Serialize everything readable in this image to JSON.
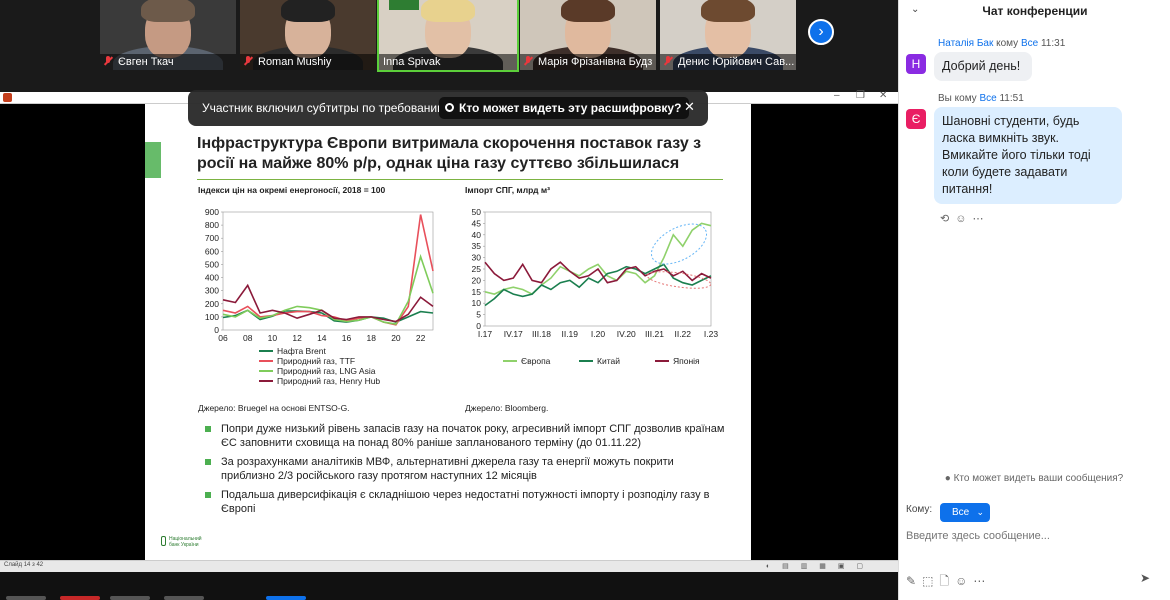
{
  "colors": {
    "zoom_blue": "#0e71eb",
    "accent_green": "#4caf50",
    "oil": "#1b7f4f",
    "ttf": "#e8505b",
    "lng": "#7fcc5b",
    "henry": "#8b1a3a",
    "china": "#1b7f4f",
    "japan": "#8b1a3a",
    "europe": "#8fd16b"
  },
  "gallery": {
    "participants": [
      {
        "name": "Євген Ткач",
        "muted": true
      },
      {
        "name": "Roman Mushiy",
        "muted": true
      },
      {
        "name": "Inna Spivak",
        "muted": false
      },
      {
        "name": "Марія Фрізанівна Будз",
        "muted": true
      },
      {
        "name": "Денис Юрійович Сав...",
        "muted": true
      }
    ],
    "next_icon": "chevron-right-icon"
  },
  "toast": {
    "text": "Участник включил субтитры по требованию",
    "button": "Кто может видеть эту расшифровку?",
    "close": "✕"
  },
  "slide": {
    "title": "Інфраструктура Європи витримала скорочення поставок газу з росії на майже 80% р/р, однак ціна газу суттєво збільшилася",
    "left_source": "Джерело: Bruegel на основі ENTSO-G.",
    "right_source": "Джерело: Bloomberg.",
    "bullets": [
      "Попри дуже низький рівень запасів газу на початок року, агресивний імпорт СПГ дозволив країнам ЄС заповнити сховища на понад 80% раніше запланованого терміну (до 01.11.22)",
      "За розрахунками аналітиків МВФ, альтернативні джерела газу та енергії можуть покрити приблизно 2/3 російського газу протягом наступних 12 місяців",
      "Подальша диверсифікація є складнішою через недостатні потужності імпорту і розподілу газу в Європі"
    ],
    "logo_line1": "Національний",
    "logo_line2": "банк України"
  },
  "chart_data": [
    {
      "type": "line",
      "title": "Індекси цін на окремі енергоносії, 2018 = 100",
      "x": [
        "06",
        "07",
        "08",
        "09",
        "10",
        "11",
        "12",
        "13",
        "14",
        "15",
        "16",
        "17",
        "18",
        "19",
        "20",
        "21",
        "22",
        "22.5"
      ],
      "x_ticks": [
        "06",
        "08",
        "10",
        "12",
        "14",
        "16",
        "18",
        "20",
        "22"
      ],
      "ylim": [
        0,
        900
      ],
      "y_ticks": [
        0,
        100,
        200,
        300,
        400,
        500,
        600,
        700,
        800,
        900
      ],
      "series": [
        {
          "name": "Нафта Brent",
          "values": [
            95,
            110,
            150,
            80,
            105,
            145,
            145,
            140,
            130,
            70,
            60,
            75,
            100,
            90,
            60,
            100,
            140,
            130
          ]
        },
        {
          "name": "Природний газ, TTF",
          "values": [
            150,
            130,
            180,
            100,
            110,
            130,
            140,
            140,
            110,
            100,
            70,
            90,
            100,
            60,
            40,
            180,
            880,
            450
          ]
        },
        {
          "name": "Природний газ, LNG Asia",
          "values": [
            120,
            100,
            150,
            90,
            110,
            150,
            180,
            170,
            150,
            80,
            65,
            75,
            100,
            60,
            45,
            220,
            560,
            280
          ]
        },
        {
          "name": "Природний газ, Henry Hub",
          "values": [
            230,
            210,
            340,
            130,
            150,
            130,
            90,
            120,
            150,
            90,
            80,
            100,
            100,
            80,
            65,
            120,
            250,
            180
          ]
        }
      ]
    },
    {
      "type": "line",
      "title": "Імпорт СПГ, млрд м³",
      "x": [
        "I.17",
        "II.17",
        "III.17",
        "IV.17",
        "I.18",
        "II.18",
        "III.18",
        "IV.18",
        "I.19",
        "II.19",
        "III.19",
        "IV.19",
        "I.20",
        "II.20",
        "III.20",
        "IV.20",
        "I.21",
        "II.21",
        "III.21",
        "IV.21",
        "I.22",
        "II.22",
        "III.22",
        "IV.22",
        "I.23"
      ],
      "x_ticks": [
        "I.17",
        "IV.17",
        "III.18",
        "II.19",
        "I.20",
        "IV.20",
        "III.21",
        "II.22",
        "I.23"
      ],
      "ylim": [
        0,
        50
      ],
      "y_ticks": [
        0,
        5,
        10,
        15,
        20,
        25,
        30,
        35,
        40,
        45,
        50
      ],
      "series": [
        {
          "name": "Європа",
          "values": [
            15,
            14,
            16,
            17,
            16,
            14,
            18,
            21,
            26,
            24,
            22,
            25,
            27,
            22,
            20,
            24,
            23,
            19,
            22,
            30,
            40,
            35,
            42,
            45,
            44
          ]
        },
        {
          "name": "Китай",
          "values": [
            9,
            12,
            16,
            14,
            13,
            14,
            18,
            16,
            19,
            20,
            17,
            21,
            19,
            23,
            24,
            26,
            25,
            23,
            25,
            27,
            21,
            19,
            18,
            20,
            22
          ]
        },
        {
          "name": "Японія",
          "values": [
            28,
            23,
            20,
            21,
            27,
            20,
            19,
            25,
            28,
            24,
            21,
            22,
            25,
            19,
            20,
            25,
            26,
            22,
            24,
            25,
            22,
            24,
            20,
            23,
            21
          ]
        }
      ]
    }
  ],
  "ppt": {
    "status": "Слайд 14 з 42",
    "status_icons": "◐ ▤ ▥ ▦ ▣ ▢"
  },
  "chat": {
    "title": "Чат конференции",
    "collapse_icon": "chevron-down-icon",
    "messages": [
      {
        "sender": "Наталія Бак",
        "to_word": "кому",
        "to": "Все",
        "time": "11:31",
        "avatar": "Н",
        "avatar_color": "#8a2be2",
        "text": "Добрий день!"
      },
      {
        "sender": "Вы",
        "to_word": "кому",
        "to": "Все",
        "time": "11:51",
        "avatar": "Є",
        "avatar_color": "#e91e63",
        "text": "Шановні студенти, будь ласка вимкніть звук. Вмикайте його тільки тоді коли будете задавати питання!"
      }
    ],
    "who_can_see": "Кто может видеть ваши сообщения?",
    "to_label": "Кому:",
    "to_value": "Все",
    "input_placeholder": "Введите здесь сообщение..."
  }
}
